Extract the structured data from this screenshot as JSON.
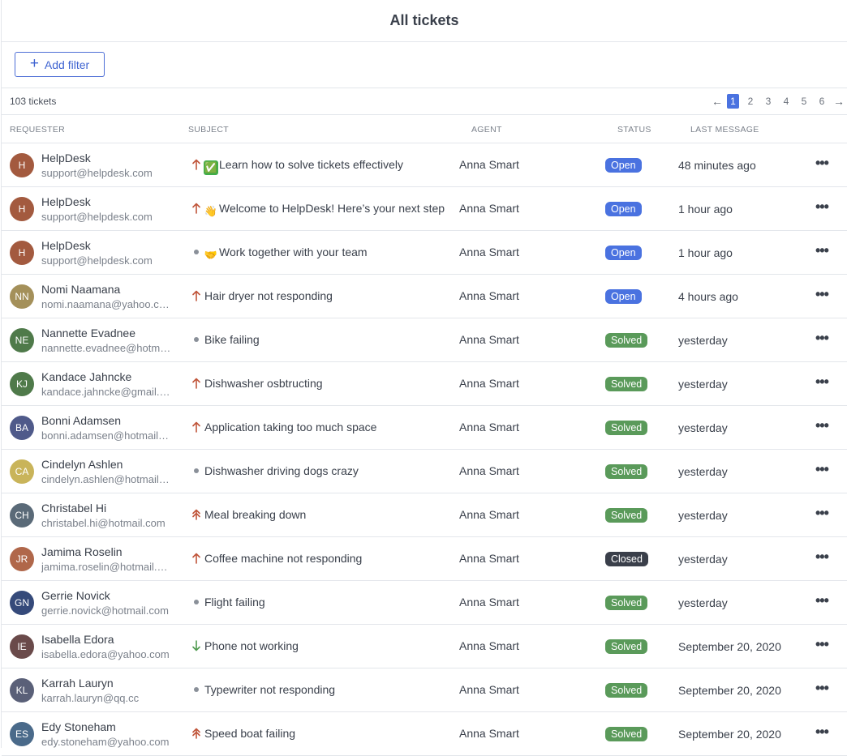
{
  "page": {
    "title": "All tickets"
  },
  "toolbar": {
    "add_filter_label": "Add filter",
    "add_icon": "+"
  },
  "list": {
    "count_label": "103 tickets",
    "pagination": {
      "prev": "←",
      "next": "→",
      "pages": [
        "1",
        "2",
        "3",
        "4",
        "5",
        "6"
      ],
      "current": "1"
    }
  },
  "columns": {
    "requester": "REQUESTER",
    "subject": "SUBJECT",
    "agent": "AGENT",
    "status": "STATUS",
    "last_message": "LAST MESSAGE"
  },
  "colors": {
    "accent": "#4a72e0",
    "status_open": "#4a72e0",
    "status_solved": "#5a9a5a",
    "status_closed": "#3a3f4a",
    "priority_high": "#c0553a",
    "priority_low": "#4f9a4f",
    "priority_normal": "#8a9099"
  },
  "tickets": [
    {
      "initials": "H",
      "avatar_color": "#a35a3f",
      "name": "HelpDesk",
      "email": "support@helpdesk.com",
      "priority": "high",
      "emoji": "✅",
      "emoji_name": "check-mark-emoji",
      "subject": "Learn how to solve tickets effectively",
      "agent": "Anna Smart",
      "status": "Open",
      "last": "48 minutes ago"
    },
    {
      "initials": "H",
      "avatar_color": "#a35a3f",
      "name": "HelpDesk",
      "email": "support@helpdesk.com",
      "priority": "high",
      "emoji": "👋",
      "emoji_name": "waving-hand-emoji",
      "subject": "Welcome to HelpDesk! Here’s your next step",
      "agent": "Anna Smart",
      "status": "Open",
      "last": "1 hour ago"
    },
    {
      "initials": "H",
      "avatar_color": "#a35a3f",
      "name": "HelpDesk",
      "email": "support@helpdesk.com",
      "priority": "normal",
      "emoji": "🤝",
      "emoji_name": "handshake-emoji",
      "subject": "Work together with your team",
      "agent": "Anna Smart",
      "status": "Open",
      "last": "1 hour ago"
    },
    {
      "initials": "NN",
      "avatar_color": "#a4905a",
      "name": "Nomi Naamana",
      "email": "nomi.naamana@yahoo.com",
      "priority": "high",
      "emoji": "",
      "subject": "Hair dryer not responding",
      "agent": "Anna Smart",
      "status": "Open",
      "last": "4 hours ago"
    },
    {
      "initials": "NE",
      "avatar_color": "#4f7a4a",
      "name": "Nannette Evadnee",
      "email": "nannette.evadnee@hotmail.com",
      "priority": "normal",
      "emoji": "",
      "subject": "Bike failing",
      "agent": "Anna Smart",
      "status": "Solved",
      "last": "yesterday"
    },
    {
      "initials": "KJ",
      "avatar_color": "#4f7a4a",
      "name": "Kandace Jahncke",
      "email": "kandace.jahncke@gmail.com",
      "priority": "high",
      "emoji": "",
      "subject": "Dishwasher osbtructing",
      "agent": "Anna Smart",
      "status": "Solved",
      "last": "yesterday"
    },
    {
      "initials": "BA",
      "avatar_color": "#4f5a8a",
      "name": "Bonni Adamsen",
      "email": "bonni.adamsen@hotmail.com",
      "priority": "high",
      "emoji": "",
      "subject": "Application taking too much space",
      "agent": "Anna Smart",
      "status": "Solved",
      "last": "yesterday"
    },
    {
      "initials": "CA",
      "avatar_color": "#c9b45a",
      "name": "Cindelyn Ashlen",
      "email": "cindelyn.ashlen@hotmail.com",
      "priority": "normal",
      "emoji": "",
      "subject": "Dishwasher driving dogs crazy",
      "agent": "Anna Smart",
      "status": "Solved",
      "last": "yesterday"
    },
    {
      "initials": "CH",
      "avatar_color": "#5a6a78",
      "name": "Christabel Hi",
      "email": "christabel.hi@hotmail.com",
      "priority": "urgent",
      "emoji": "",
      "subject": "Meal breaking down",
      "agent": "Anna Smart",
      "status": "Solved",
      "last": "yesterday"
    },
    {
      "initials": "JR",
      "avatar_color": "#b0674a",
      "name": "Jamima Roselin",
      "email": "jamima.roselin@hotmail.com",
      "priority": "high",
      "emoji": "",
      "subject": "Coffee machine not responding",
      "agent": "Anna Smart",
      "status": "Closed",
      "last": "yesterday"
    },
    {
      "initials": "GN",
      "avatar_color": "#354a7a",
      "name": "Gerrie Novick",
      "email": "gerrie.novick@hotmail.com",
      "priority": "normal",
      "emoji": "",
      "subject": "Flight failing",
      "agent": "Anna Smart",
      "status": "Solved",
      "last": "yesterday"
    },
    {
      "initials": "IE",
      "avatar_color": "#6a4a4a",
      "name": "Isabella Edora",
      "email": "isabella.edora@yahoo.com",
      "priority": "low",
      "emoji": "",
      "subject": "Phone not working",
      "agent": "Anna Smart",
      "status": "Solved",
      "last": "September 20, 2020"
    },
    {
      "initials": "KL",
      "avatar_color": "#5a6078",
      "name": "Karrah Lauryn",
      "email": "karrah.lauryn@qq.cc",
      "priority": "normal",
      "emoji": "",
      "subject": "Typewriter not responding",
      "agent": "Anna Smart",
      "status": "Solved",
      "last": "September 20, 2020"
    },
    {
      "initials": "ES",
      "avatar_color": "#4a6a8a",
      "name": "Edy Stoneham",
      "email": "edy.stoneham@yahoo.com",
      "priority": "urgent",
      "emoji": "",
      "subject": "Speed boat failing",
      "agent": "Anna Smart",
      "status": "Solved",
      "last": "September 20, 2020"
    }
  ]
}
